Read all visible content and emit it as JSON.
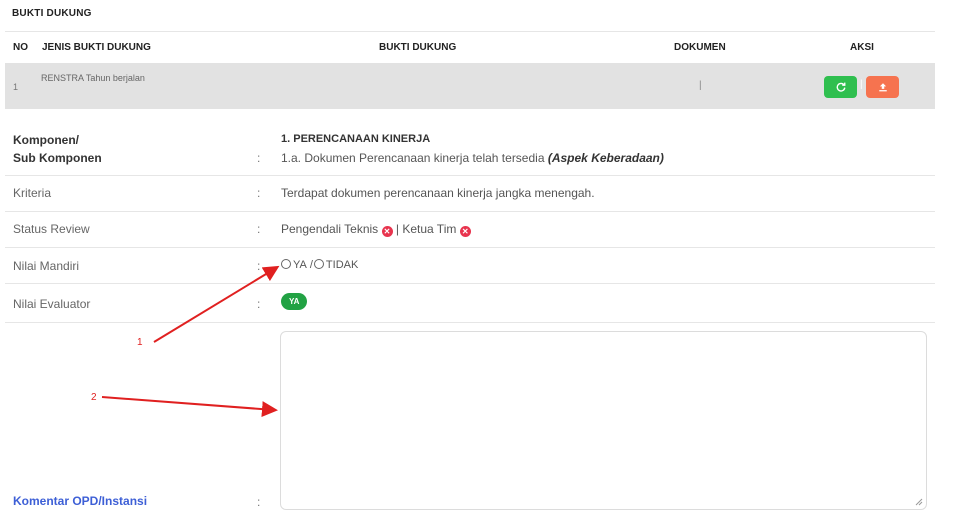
{
  "section": {
    "title": "BUKTI DUKUNG"
  },
  "table": {
    "headers": [
      "NO",
      "JENIS BUKTI DUKUNG",
      "BUKTI DUKUNG",
      "DOKUMEN",
      "AKSI"
    ],
    "rows": [
      {
        "no": "1",
        "jenis": "RENSTRA Tahun berjalan",
        "bukti": "",
        "dokumen": "|"
      }
    ],
    "action_separator": "|"
  },
  "form": {
    "komponen_label_1": "Komponen/",
    "komponen_label_2": "Sub Komponen",
    "komponen_value_1": "1. PERENCANAAN KINERJA",
    "komponen_value_2_prefix": "1.a. Dokumen Perencanaan kinerja telah tersedia ",
    "komponen_value_2_emph": "(Aspek Keberadaan)",
    "kriteria_label": "Kriteria",
    "kriteria_value": "Terdapat dokumen perencanaan kinerja jangka menengah.",
    "status_label": "Status Review",
    "status_pengendali": "Pengendali Teknis",
    "status_sep": " | ",
    "status_ketua": "Ketua Tim",
    "nilai_mandiri_label": "Nilai Mandiri",
    "nilai_mandiri_opt_ya": "YA",
    "nilai_mandiri_sep": "/",
    "nilai_mandiri_opt_tidak": "TIDAK",
    "nilai_evaluator_label": "Nilai Evaluator",
    "nilai_evaluator_value": "YA",
    "komentar_label": "Komentar OPD/Instansi",
    "colon": ":"
  },
  "annotations": {
    "arrow1": "1",
    "arrow2": "2"
  },
  "colors": {
    "refresh": "#2fbf4f",
    "upload": "#f6734f",
    "badge": "#22a244",
    "reject": "#e8344e",
    "link": "#3d5fd6",
    "annotation": "#e02020"
  }
}
